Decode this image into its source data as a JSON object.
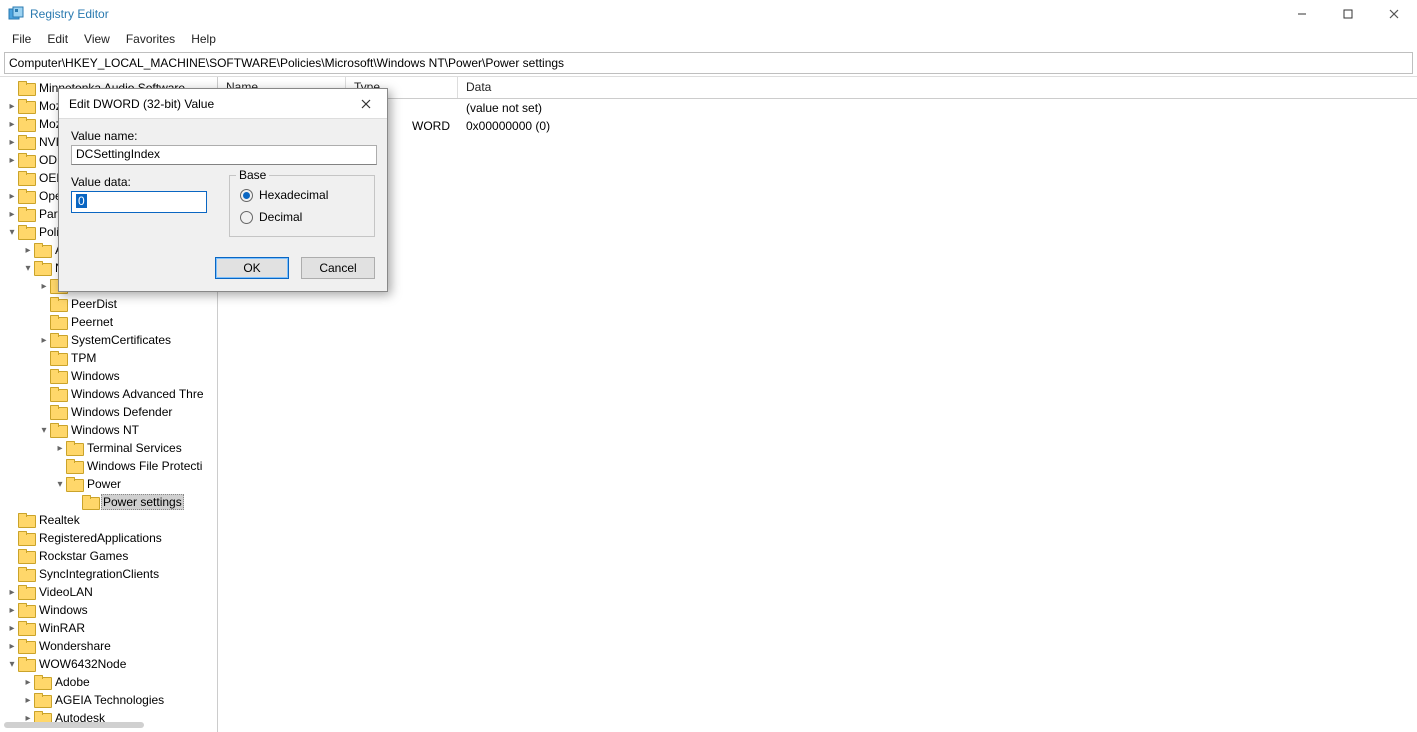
{
  "app": {
    "title": "Registry Editor"
  },
  "menus": {
    "file": "File",
    "edit": "Edit",
    "view": "View",
    "favorites": "Favorites",
    "help": "Help"
  },
  "path": "Computer\\HKEY_LOCAL_MACHINE\\SOFTWARE\\Policies\\Microsoft\\Windows NT\\Power\\Power settings",
  "columns": {
    "name": "Name",
    "type": "Type",
    "data": "Data"
  },
  "rows": [
    {
      "type_suffix": "",
      "data": "(value not set)"
    },
    {
      "type_suffix": "WORD",
      "data": "0x00000000 (0)"
    }
  ],
  "tree": {
    "n0": "Minnetonka Audio Software",
    "n1": "Moz",
    "n2": "Moz",
    "n3": "NVII",
    "n4": "ODE",
    "n5": "OEN",
    "n6": "Ope",
    "n7": "Part",
    "n8": "Poli",
    "n10": "PeerDist",
    "n11": "Peernet",
    "n12": "SystemCertificates",
    "n13": "TPM",
    "n14": "Windows",
    "n15": "Windows Advanced Thre",
    "n16": "Windows Defender",
    "n17": "Windows NT",
    "n18": "Terminal Services",
    "n19": "Windows File Protecti",
    "n20": "Power",
    "n21": "Power settings",
    "n22": "Realtek",
    "n23": "RegisteredApplications",
    "n24": "Rockstar Games",
    "n25": "SyncIntegrationClients",
    "n26": "VideoLAN",
    "n27": "Windows",
    "n28": "WinRAR",
    "n29": "Wondershare",
    "n30": "WOW6432Node",
    "n31": "Adobe",
    "n32": "AGEIA Technologies",
    "n33": "Autodesk"
  },
  "dialog": {
    "title": "Edit DWORD (32-bit) Value",
    "value_name_label": "Value name:",
    "value_name": "DCSettingIndex",
    "value_data_label": "Value data:",
    "value_data": "0",
    "base_label": "Base",
    "hex": "Hexadecimal",
    "dec": "Decimal",
    "ok": "OK",
    "cancel": "Cancel"
  }
}
